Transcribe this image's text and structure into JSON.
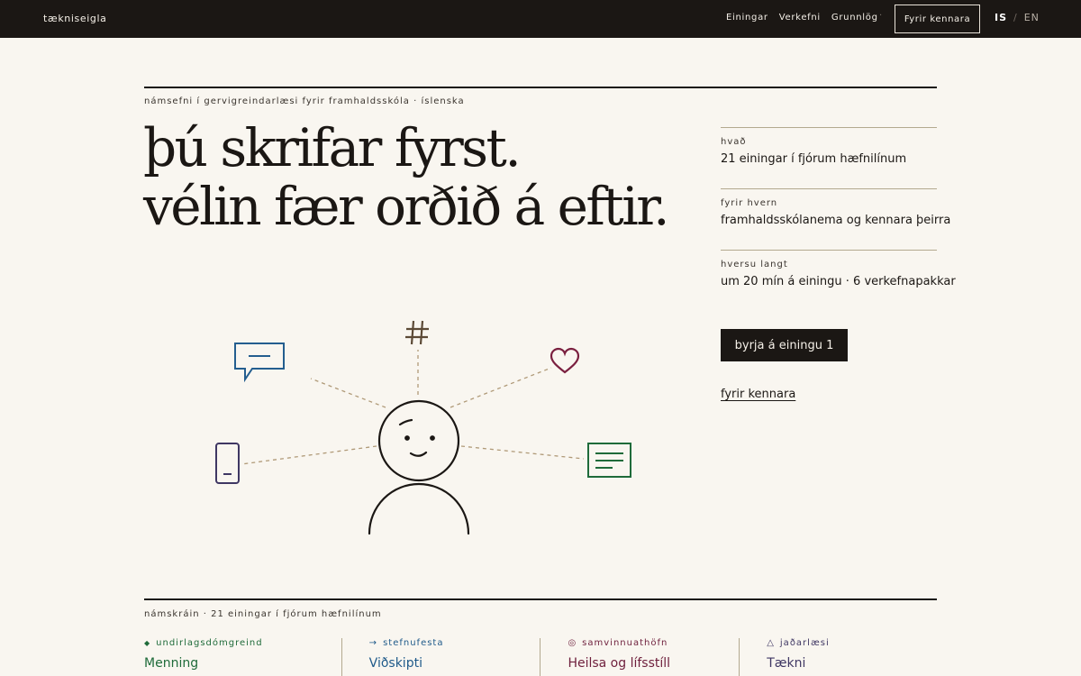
{
  "header": {
    "brand": "tækniseigla",
    "nav": [
      "Einingar",
      "Verkefni",
      "Grunnlög"
    ],
    "separator": "·",
    "teacher_button": "Fyrir kennara",
    "lang_active": "IS",
    "lang_separator": "/",
    "lang_inactive": "EN"
  },
  "hero": {
    "kicker": "námsefni í gervigreindarlæsi fyrir framhaldsskóla · íslenska",
    "headline_1": "þú skrifar fyrst.",
    "headline_2": "vélin fær orðið á eftir."
  },
  "facts": [
    {
      "label": "hvað",
      "value": "21 einingar í fjórum hæfnilínum"
    },
    {
      "label": "fyrir hvern",
      "value": "framhaldsskólanema og kennara þeirra"
    },
    {
      "label": "hversu langt",
      "value": "um 20 mín á einingu · 6 verkefnapakkar"
    }
  ],
  "cta_label": "byrja á einingu 1",
  "teacher_link": "fyrir kennara",
  "illustration_colors": {
    "chat": "#245e8f",
    "hash": "#5c4a36",
    "heart": "#7a1f3f",
    "phone": "#3f3763",
    "doc": "#1f6b3a",
    "lines": "#b09a78",
    "person": "#1b1714"
  },
  "curriculum": {
    "title": "námskráin · 21 einingar í fjórum hæfnilínum",
    "tracks": [
      {
        "icon": "diamond-icon",
        "symbol": "◆",
        "label": "undirlagsdómgreind",
        "name": "Menning",
        "color": "#1f6b3a"
      },
      {
        "icon": "arrow-right-icon",
        "symbol": "→",
        "label": "stefnufesta",
        "name": "Viðskipti",
        "color": "#1f5a8a"
      },
      {
        "icon": "circle-target-icon",
        "symbol": "◎",
        "label": "samvinnuathöfn",
        "name": "Heilsa og lífsstíll",
        "color": "#6e1f3c"
      },
      {
        "icon": "triangle-icon",
        "symbol": "△",
        "label": "jaðarlæsi",
        "name": "Tækni",
        "color": "#3f3763"
      }
    ]
  }
}
